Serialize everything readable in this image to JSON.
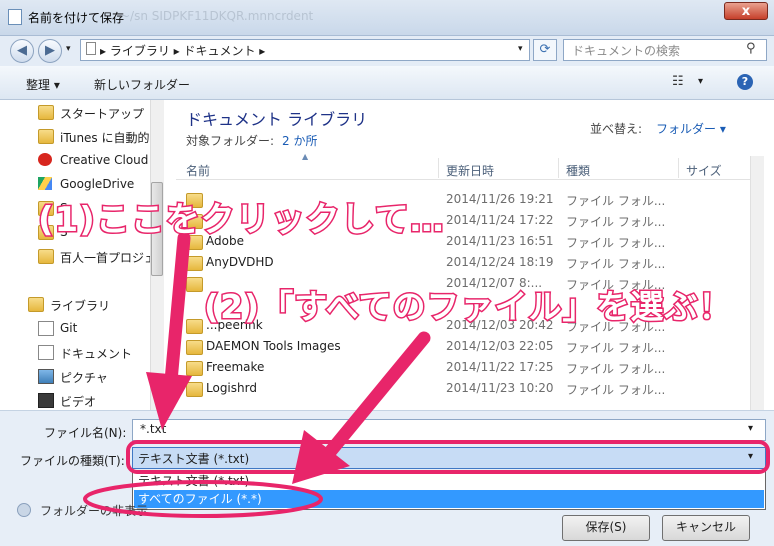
{
  "window": {
    "title": "名前を付けて保存",
    "blurred_title": "~/sn SIDPKF11DKQR.mnncrdent",
    "close_label": "x"
  },
  "address": {
    "path": "▸ ライブラリ ▸ ドキュメント ▸",
    "search_placeholder": "ドキュメントの検索"
  },
  "toolbar": {
    "organize": "整理 ▾",
    "new_folder": "新しいフォルダー",
    "help": "?"
  },
  "nav": {
    "items": [
      {
        "label": "スタートアップ",
        "icon": "folder-icon"
      },
      {
        "label": "iTunes に自動的",
        "icon": "folder-icon"
      },
      {
        "label": "Creative Cloud",
        "icon": "creative-cloud-icon"
      },
      {
        "label": "GoogleDrive",
        "icon": "google-drive-icon"
      },
      {
        "label": "S",
        "icon": "folder-icon"
      },
      {
        "label": "S",
        "icon": "folder-icon"
      },
      {
        "label": "百人一首プロジェ",
        "icon": "folder-icon"
      },
      {
        "label": "ライブラリ",
        "icon": "library-icon"
      },
      {
        "label": "Git",
        "icon": "git-icon"
      },
      {
        "label": "ドキュメント",
        "icon": "document-icon"
      },
      {
        "label": "ピクチャ",
        "icon": "picture-icon"
      },
      {
        "label": "ビデオ",
        "icon": "video-icon"
      }
    ]
  },
  "library": {
    "title": "ドキュメント ライブラリ",
    "subtitle": "対象フォルダー:",
    "subtitle_link": "2 か所",
    "sort_label": "並べ替え:",
    "sort_value": "フォルダー ▾"
  },
  "columns": [
    "名前",
    "更新日時",
    "種類",
    "サイズ"
  ],
  "files": [
    {
      "name": "",
      "date": "2014/11/26 19:21",
      "type": "ファイル フォル..."
    },
    {
      "name": "",
      "date": "2014/11/24 17:22",
      "type": "ファイル フォル..."
    },
    {
      "name": "Adobe",
      "date": "2014/11/23 16:51",
      "type": "ファイル フォル..."
    },
    {
      "name": "AnyDVDHD",
      "date": "2014/12/24 18:19",
      "type": "ファイル フォル..."
    },
    {
      "name": "",
      "date": "2014/12/07 8:...",
      "type": "ファイル フォル..."
    },
    {
      "name": "...peerink",
      "date": "2014/12/03 20:42",
      "type": "ファイル フォル..."
    },
    {
      "name": "DAEMON Tools Images",
      "date": "2014/12/03 22:05",
      "type": "ファイル フォル..."
    },
    {
      "name": "Freemake",
      "date": "2014/11/22 17:25",
      "type": "ファイル フォル..."
    },
    {
      "name": "Logishrd",
      "date": "2014/11/23 10:20",
      "type": "ファイル フォル..."
    }
  ],
  "save": {
    "filename_label": "ファイル名(N):",
    "filename_value": "*.txt",
    "filetype_label": "ファイルの種類(T):",
    "filetype_value": "テキスト文書 (*.txt)",
    "options": [
      "テキスト文書 (*.txt)",
      "すべてのファイル  (*.*)"
    ],
    "hide_folders": "フォルダーの非表示",
    "save_button": "保存(S)",
    "cancel_button": "キャンセル"
  },
  "annotations": {
    "step1": "(1)ここをクリックして…",
    "step2": "(2)「すべてのファイル」を選ぶ！",
    "color": "#e8256a"
  }
}
